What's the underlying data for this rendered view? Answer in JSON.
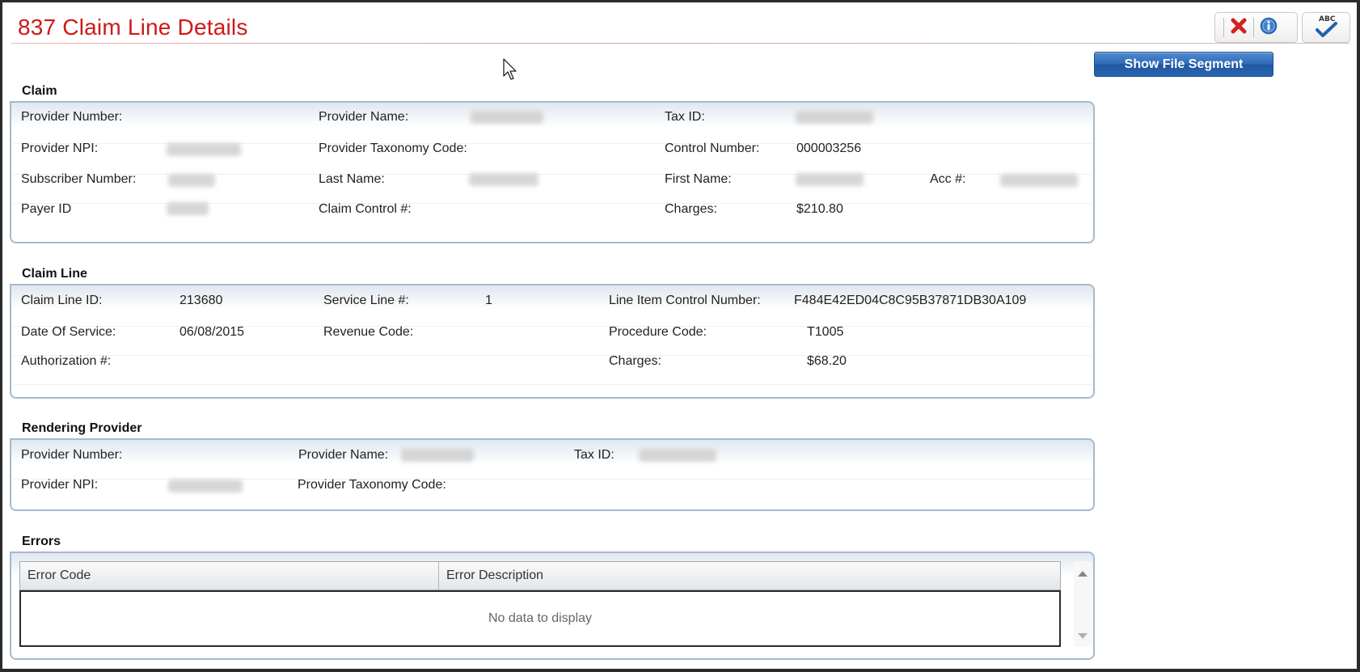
{
  "header": {
    "title": "837 Claim Line Details",
    "show_file_segment_label": "Show File Segment",
    "toolbar": {
      "close_icon": "red-x-icon",
      "info_icon": "info-icon",
      "spellcheck_icon": "spellcheck-icon",
      "spellcheck_text": "ABC"
    }
  },
  "claim": {
    "tab_label": "Claim",
    "provider_number_label": "Provider Number:",
    "provider_name_label": "Provider Name:",
    "tax_id_label": "Tax ID:",
    "provider_npi_label": "Provider NPI:",
    "provider_taxonomy_label": "Provider Taxonomy Code:",
    "control_number_label": "Control Number:",
    "control_number_value": "000003256",
    "subscriber_number_label": "Subscriber Number:",
    "last_name_label": "Last Name:",
    "first_name_label": "First Name:",
    "acc_label": "Acc #:",
    "payer_id_label": "Payer ID",
    "claim_control_label": "Claim Control #:",
    "charges_label": "Charges:",
    "charges_value": "$210.80"
  },
  "claim_line": {
    "tab_label": "Claim Line",
    "claim_line_id_label": "Claim Line ID:",
    "claim_line_id_value": "213680",
    "service_line_label": "Service Line #:",
    "service_line_value": "1",
    "line_item_control_label": "Line Item Control Number:",
    "line_item_control_value": "F484E42ED04C8C95B37871DB30A109",
    "date_of_service_label": "Date Of Service:",
    "date_of_service_value": "06/08/2015",
    "revenue_code_label": "Revenue Code:",
    "procedure_code_label": "Procedure Code:",
    "procedure_code_value": "T1005",
    "authorization_label": "Authorization #:",
    "charges_label": "Charges:",
    "charges_value": "$68.20"
  },
  "rendering_provider": {
    "tab_label": "Rendering Provider",
    "provider_number_label": "Provider Number:",
    "provider_name_label": "Provider Name:",
    "tax_id_label": "Tax ID:",
    "provider_npi_label": "Provider NPI:",
    "provider_taxonomy_label": "Provider Taxonomy Code:"
  },
  "errors": {
    "tab_label": "Errors",
    "columns": [
      "Error Code",
      "Error Description"
    ],
    "empty_text": "No data to display"
  },
  "colors": {
    "title": "#d01818",
    "button_blue": "#2f69b4",
    "panel_border": "#a7b9cb"
  }
}
